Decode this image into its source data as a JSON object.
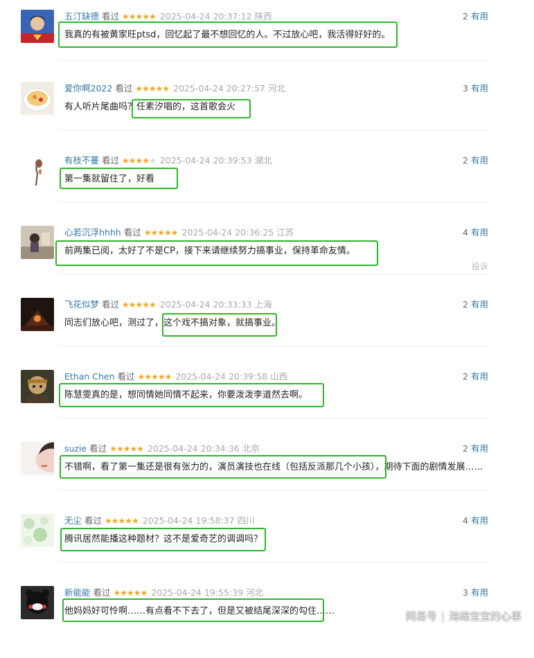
{
  "seen_label": "看过",
  "useful_label": "有用",
  "report_label": "投诉",
  "comments": [
    {
      "user": "五汀缺德",
      "stars": 5,
      "time": "2025-04-24 20:37:12",
      "location": "陕西",
      "votes": "2",
      "text": "我真的有被黄家旺ptsd，回忆起了最不想回忆的人。不过放心吧，我活得好好的。"
    },
    {
      "user": "爱你啊2022",
      "stars": 5,
      "time": "2025-04-24 20:27:57",
      "location": "河北",
      "votes": "3",
      "text": "有人听片尾曲吗？任素汐唱的，这首歌会火"
    },
    {
      "user": "有枝不蔓",
      "stars": 4,
      "time": "2025-04-24 20:39:53",
      "location": "湖北",
      "votes": "2",
      "text": "第一集就留住了，好看"
    },
    {
      "user": "心若沉浮hhhh",
      "stars": 5,
      "time": "2025-04-24 20:36:25",
      "location": "江苏",
      "votes": "4",
      "text": "前两集已阅，太好了不是CP，接下来请继续努力搞事业，保持革命友情。"
    },
    {
      "user": "飞花似梦",
      "stars": 5,
      "time": "2025-04-24 20:33:33",
      "location": "上海",
      "votes": "2",
      "text": "同志们放心吧，测过了，这个戏不搞对象，就搞事业。"
    },
    {
      "user": "Ethan Chen",
      "stars": 5,
      "time": "2025-04-24 20:39:58",
      "location": "山西",
      "votes": "2",
      "text": "陈慧雯真的是，想同情她同情不起来，你要泼泼李道然去啊。"
    },
    {
      "user": "suzie",
      "stars": 5,
      "time": "2025-04-24 20:34:36",
      "location": "北京",
      "votes": "2",
      "text": "不错啊，看了第一集还是很有张力的，演员演技也在线（包括反派那几个小孩），期待下面的剧情发展……"
    },
    {
      "user": "无尘",
      "stars": 5,
      "time": "2025-04-24 19:58:37",
      "location": "四川",
      "votes": "4",
      "text": "腾讯居然能播这种题材？这不是爱奇艺的调调吗？"
    },
    {
      "user": "新能能",
      "stars": 5,
      "time": "2025-04-24 19:55:39",
      "location": "河北",
      "votes": "3",
      "text": "他妈妈好可怜啊……有点看不下去了，但是又被结尾深深的勾住……"
    }
  ],
  "watermark": {
    "site": "网易号",
    "author": "海绵宝宝的心事"
  },
  "colors": {
    "highlight": "#2db52a",
    "username": "#3377aa",
    "stars": "#f5a623"
  }
}
